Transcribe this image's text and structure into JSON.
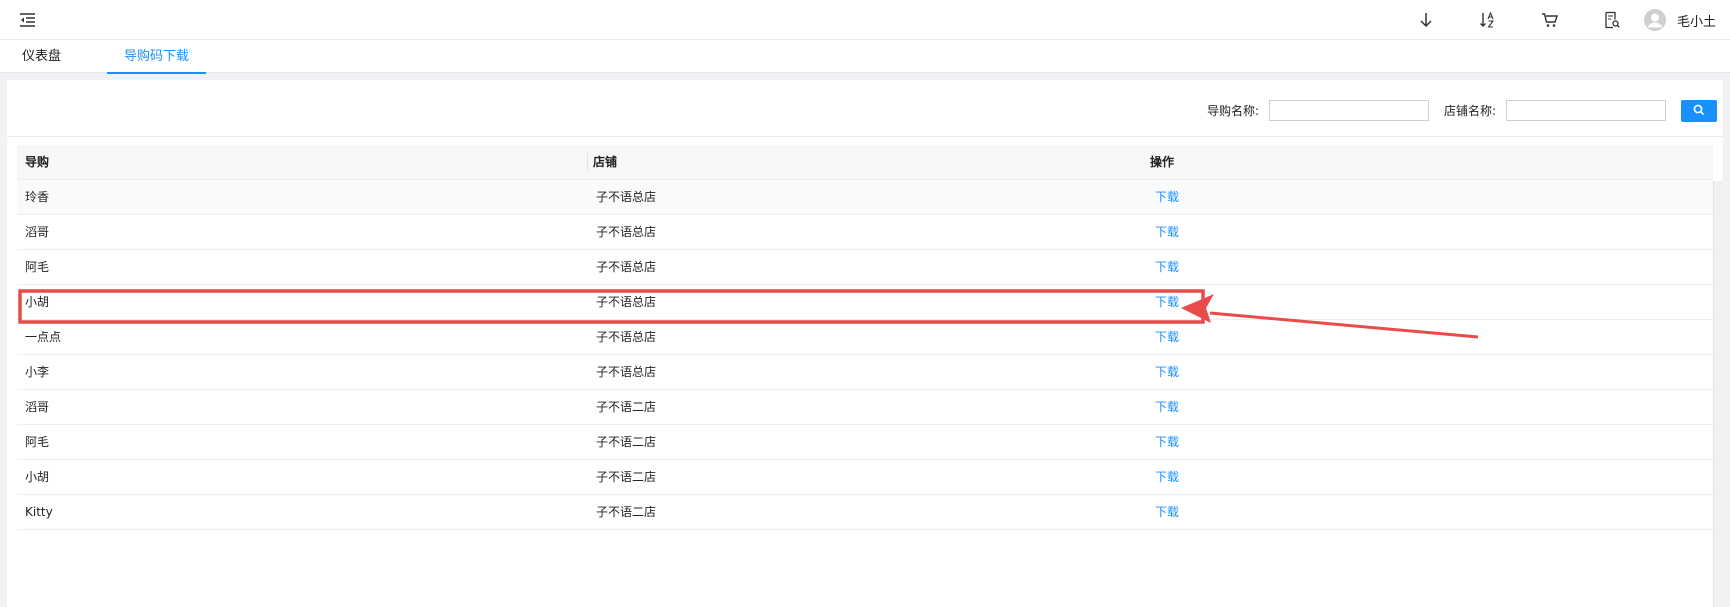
{
  "topbar": {
    "icons": [
      "menu-fold-icon",
      "arrow-down-icon",
      "sort-az-icon",
      "cart-icon",
      "document-search-icon",
      "user-avatar-icon"
    ],
    "username": "毛小土"
  },
  "tabs": [
    {
      "label": "仪表盘",
      "active": false
    },
    {
      "label": "导购码下载",
      "active": true
    }
  ],
  "search": {
    "guide_label": "导购名称:",
    "guide_value": "",
    "store_label": "店铺名称:",
    "store_value": "",
    "button_icon": "search-icon"
  },
  "table": {
    "columns": [
      "导购",
      "店铺",
      "操作"
    ],
    "rows": [
      {
        "guide": "玲香",
        "store": "子不语总店",
        "action": "下载"
      },
      {
        "guide": "滔哥",
        "store": "子不语总店",
        "action": "下载"
      },
      {
        "guide": "阿毛",
        "store": "子不语总店",
        "action": "下载"
      },
      {
        "guide": "小胡",
        "store": "子不语总店",
        "action": "下载"
      },
      {
        "guide": "一点点",
        "store": "子不语总店",
        "action": "下载"
      },
      {
        "guide": "小李",
        "store": "子不语总店",
        "action": "下载"
      },
      {
        "guide": "滔哥",
        "store": "子不语二店",
        "action": "下载"
      },
      {
        "guide": "阿毛",
        "store": "子不语二店",
        "action": "下载"
      },
      {
        "guide": "小胡",
        "store": "子不语二店",
        "action": "下载"
      },
      {
        "guide": "Kitty",
        "store": "子不语二店",
        "action": "下载"
      }
    ]
  },
  "colors": {
    "accent": "#1890ff",
    "annotation": "#e94b4b"
  }
}
